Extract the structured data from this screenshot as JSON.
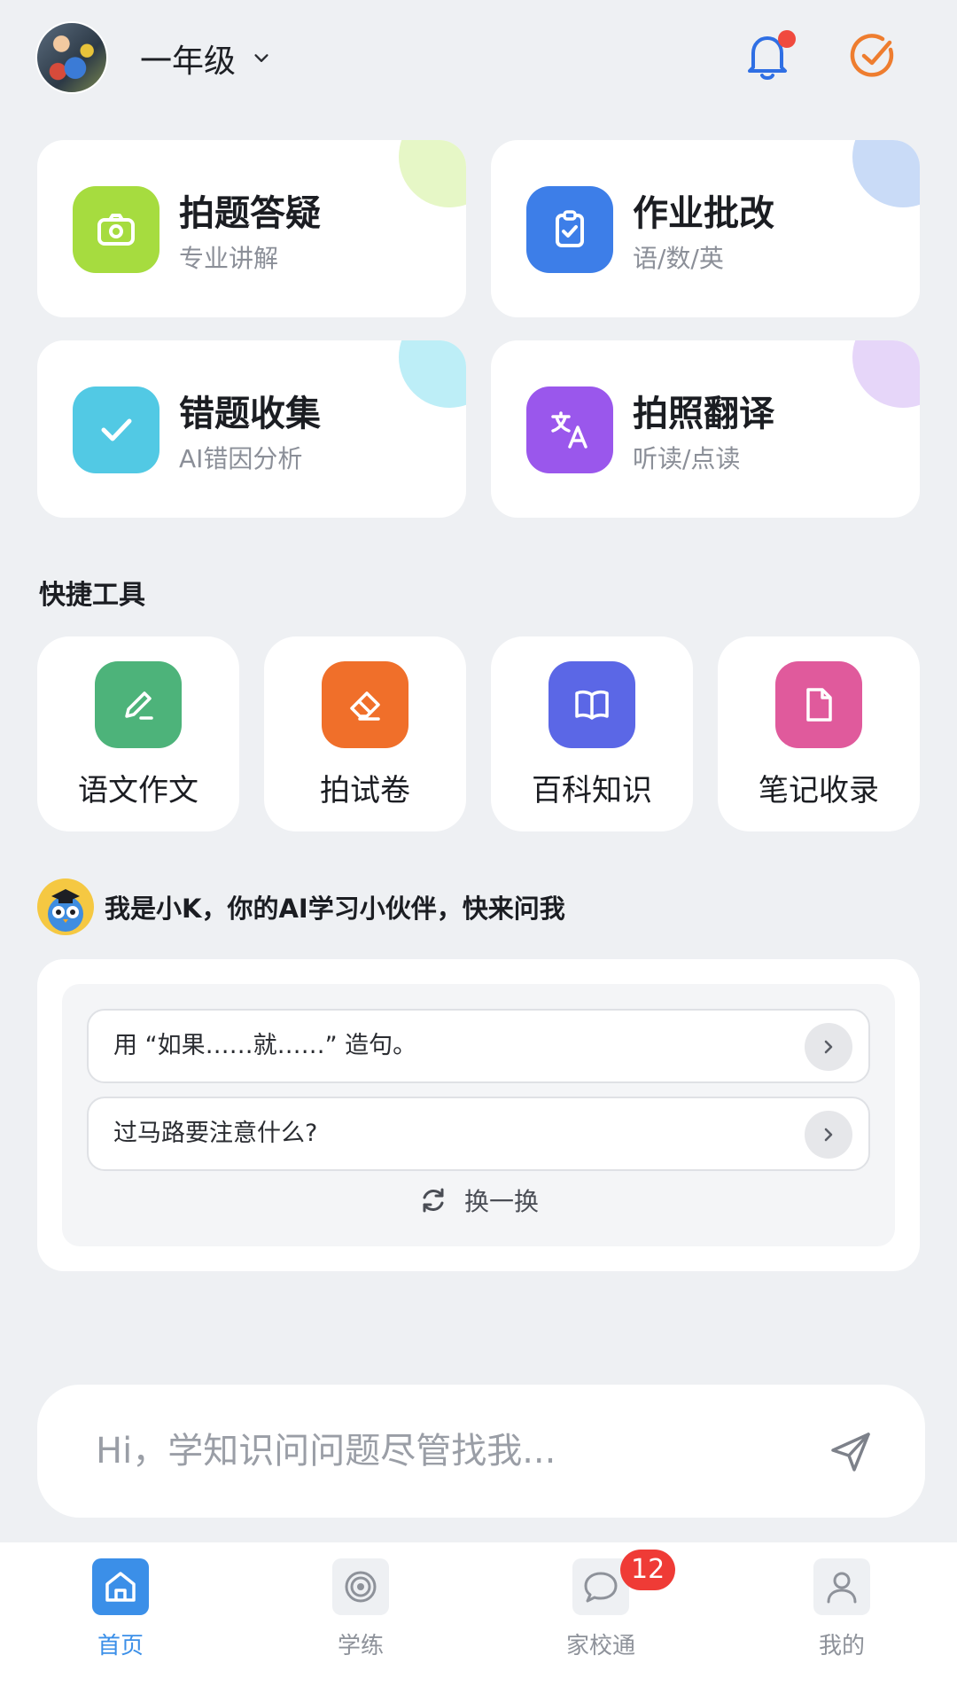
{
  "header": {
    "grade_label": "一年级"
  },
  "feature_cards": [
    {
      "title": "拍题答疑",
      "subtitle": "专业讲解",
      "icon": "camera-icon",
      "color": "#a6dc3f",
      "corner": "#e6f7c6"
    },
    {
      "title": "作业批改",
      "subtitle": "语/数/英",
      "icon": "clipboard-check-icon",
      "color": "#3d7ee8",
      "corner": "#c9dbf7"
    },
    {
      "title": "错题收集",
      "subtitle": "AI错因分析",
      "icon": "check-icon",
      "color": "#52c9e4",
      "corner": "#bdeef7"
    },
    {
      "title": "拍照翻译",
      "subtitle": "听读/点读",
      "icon": "translate-icon",
      "color": "#9a57ec",
      "corner": "#e6d6f9"
    }
  ],
  "quick_tools": {
    "title": "快捷工具",
    "items": [
      {
        "label": "语文作文",
        "icon": "pencil-icon",
        "color": "#4db37a"
      },
      {
        "label": "拍试卷",
        "icon": "eraser-icon",
        "color": "#f06f2a"
      },
      {
        "label": "百科知识",
        "icon": "book-icon",
        "color": "#5b67e6"
      },
      {
        "label": "笔记收录",
        "icon": "note-icon",
        "color": "#e05a9c"
      }
    ]
  },
  "ai_partner": {
    "intro": "我是小K，你的AI学习小伙伴，快来问我",
    "suggestions": [
      "用 “如果……就……” 造句。",
      "过马路要注意什么?"
    ],
    "refresh_label": "换一换"
  },
  "chat_input": {
    "placeholder": "Hi，学知识问问题尽管找我..."
  },
  "bottom_nav": {
    "items": [
      {
        "label": "首页",
        "icon": "home-icon",
        "active": true
      },
      {
        "label": "学练",
        "icon": "target-icon",
        "active": false
      },
      {
        "label": "家校通",
        "icon": "chat-bubble-icon",
        "active": false
      },
      {
        "label": "我的",
        "icon": "profile-icon",
        "active": false
      }
    ],
    "badge_count": "12"
  },
  "colors": {
    "background": "#eef0f3",
    "accent_blue": "#3b8fe8",
    "check_orange": "#ee7d2f",
    "notification_red": "#f04a3e"
  }
}
